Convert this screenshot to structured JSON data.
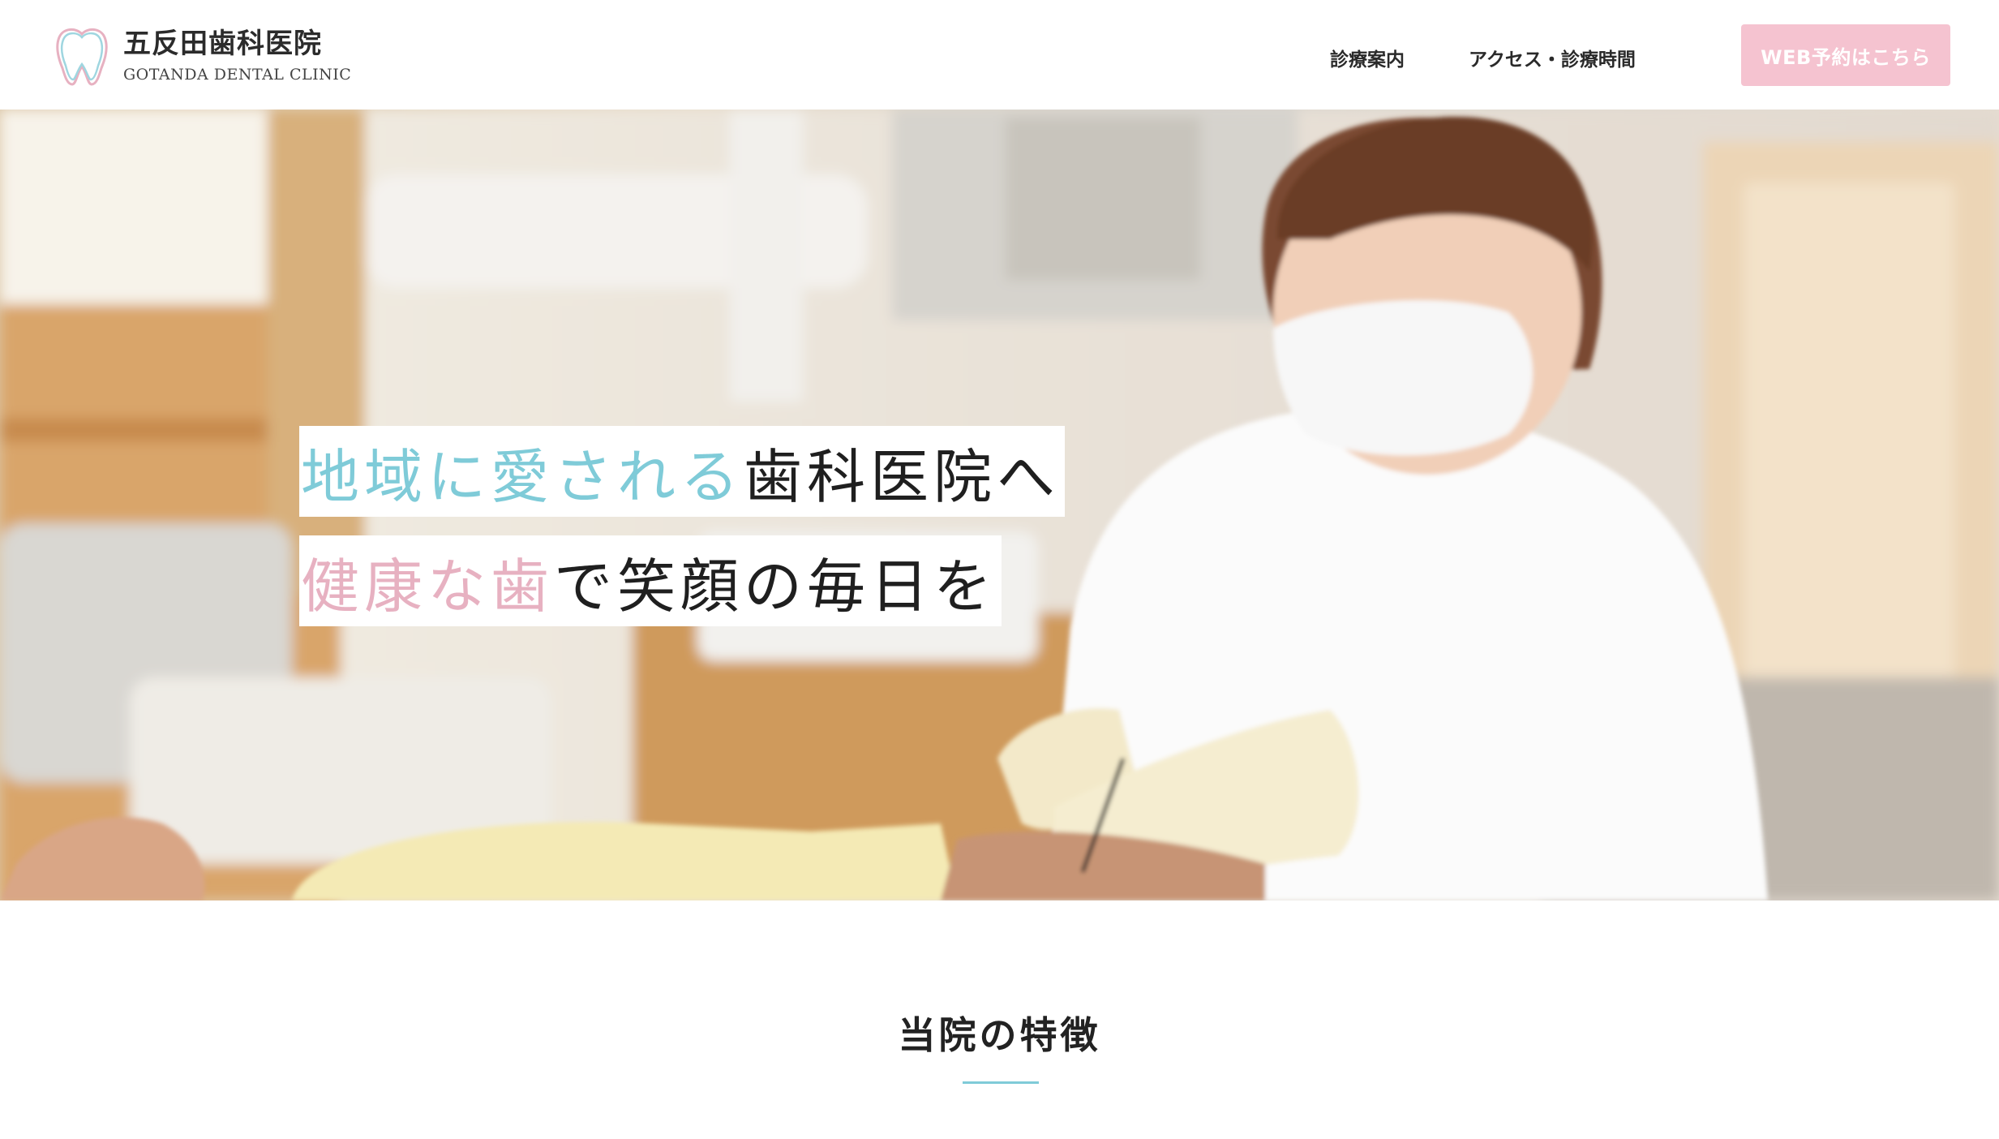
{
  "header": {
    "clinic_name": "五反田歯科医院",
    "clinic_name_en": "GOTANDA DENTAL CLINIC",
    "nav": [
      {
        "label": "診療案内"
      },
      {
        "label": "アクセス・診療時間"
      }
    ],
    "cta_label": "WEB予約はこちら"
  },
  "hero": {
    "catch1": {
      "blue": "地域に愛される",
      "dark": "歯科医院へ"
    },
    "catch2": {
      "pink": "健康な歯",
      "dark": "で笑顔の毎日を"
    },
    "image": "dentist-treating-patient-photo"
  },
  "section": {
    "title": "当院の特徴"
  },
  "colors": {
    "accent_blue": "#7fcbd8",
    "accent_pink": "#e7b1c1",
    "cta_pink": "#f5c3d0"
  }
}
